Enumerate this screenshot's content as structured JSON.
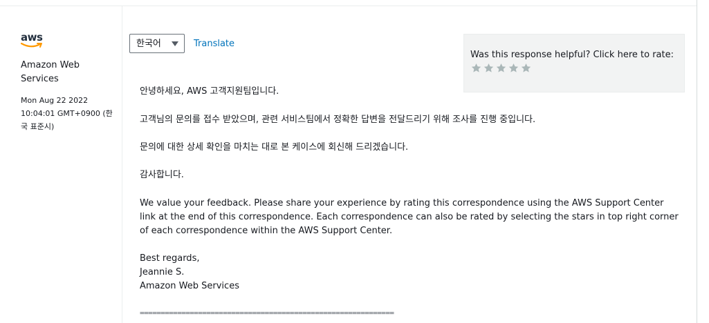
{
  "sender": {
    "logo_text": "aws",
    "name": "Amazon Web Services",
    "date": "Mon Aug 22 2022 10:04:01 GMT+0900 (한국 표준시)"
  },
  "toolbar": {
    "language_selected": "한국어",
    "translate_label": "Translate"
  },
  "rating": {
    "prompt": "Was this response helpful? Click here to rate:",
    "stars_total": 5,
    "stars_filled": 0,
    "star_color": "#aab7b8"
  },
  "message": {
    "greeting": "안녕하세요, AWS 고객지원팀입니다.",
    "line1": "고객님의 문의를 접수 받았으며, 관련 서비스팀에서 정확한 답변을 전달드리기 위해 조사를 진행 중입니다.",
    "line2": "문의에 대한 상세 확인을 마치는 대로 본 케이스에 회신해 드리겠습니다.",
    "thanks": "감사합니다.",
    "feedback": "We value your feedback. Please share your experience by rating this correspondence using the AWS Support Center link at the end of this correspondence. Each correspondence can also be rated by selecting the stars in top right corner of each correspondence within the AWS Support Center.",
    "signoff": "Best regards,",
    "signer": "Jeannie S.",
    "company": "Amazon Web Services",
    "separator": "============================================================="
  },
  "colors": {
    "link": "#0073bb",
    "logo_smile": "#ff9900",
    "logo_text": "#232f3e"
  }
}
